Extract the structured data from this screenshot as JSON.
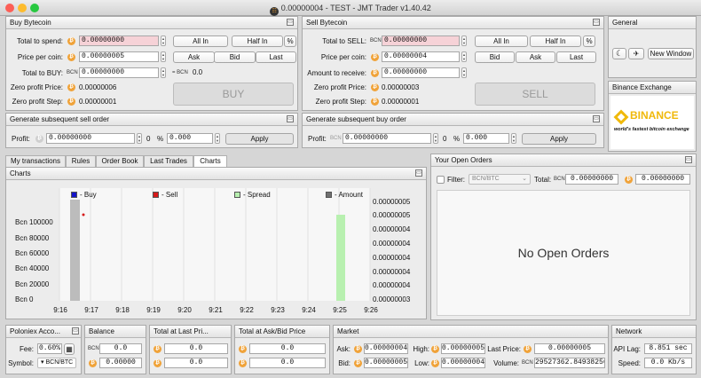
{
  "window": {
    "title": "0.00000004 - TEST - JMT Trader v1.40.42"
  },
  "colors": {
    "coin": "#f0a33a",
    "highlight": "#f6d2d7",
    "buy": "#1515c9",
    "sell": "#d61a1a",
    "spread": "#b8f0b0",
    "amount": "#707070"
  },
  "buy_panel": {
    "title": "Buy Bytecoin",
    "total_to_spend_label": "Total to spend:",
    "total_to_spend": "0.00000000",
    "price_label": "Price per coin:",
    "price": "0.00000005",
    "total_to_buy_label": "Total to BUY:",
    "total_to_buy": "0.00000000",
    "unit": "BCN",
    "eq_label": "= BCN",
    "eq_value": "0.0",
    "zero_price_label": "Zero profit Price:",
    "zero_price": "0.00000006",
    "zero_step_label": "Zero profit Step:",
    "zero_step": "0.00000001",
    "all_in": "All In",
    "half_in": "Half In",
    "pct": "%",
    "ask": "Ask",
    "bid": "Bid",
    "last": "Last",
    "action": "BUY"
  },
  "sell_panel": {
    "title": "Sell Bytecoin",
    "total_to_sell_label": "Total to SELL:",
    "total_to_sell": "0.00000000",
    "price_label": "Price per coin:",
    "price": "0.00000004",
    "receive_label": "Amount to receive:",
    "receive": "0.00000000",
    "unit": "BCN",
    "zero_price_label": "Zero profit Price:",
    "zero_price": "0.00000003",
    "zero_step_label": "Zero profit Step:",
    "zero_step": "0.00000001",
    "all_in": "All In",
    "half_in": "Half In",
    "pct": "%",
    "bid": "Bid",
    "ask": "Ask",
    "last": "Last",
    "action": "SELL"
  },
  "general": {
    "title": "General",
    "new_window": "New Window"
  },
  "exchange": {
    "title": "Binance Exchange",
    "name": "BINANCE",
    "slogan": "world's fastest bitcoin exchange"
  },
  "gen_sell": {
    "title": "Generate subsequent sell order",
    "profit_label": "Profit:",
    "profit": "0.00000000",
    "count": "0",
    "pct_label": "%",
    "pct": "0.000",
    "apply": "Apply"
  },
  "gen_buy": {
    "title": "Generate subsequent buy order",
    "profit_label": "Profit:",
    "unit": "BCN",
    "profit": "0.00000000",
    "count": "0",
    "pct_label": "%",
    "pct": "0.000",
    "apply": "Apply"
  },
  "tabs": [
    "My transactions",
    "Rules",
    "Order Book",
    "Last Trades",
    "Charts"
  ],
  "charts_panel": {
    "title": "Charts"
  },
  "chart_data": {
    "type": "bar",
    "legend": [
      "- Buy",
      "- Sell",
      "- Spread",
      "- Amount"
    ],
    "x_ticks": [
      "9:16",
      "9:17",
      "9:18",
      "9:19",
      "9:20",
      "9:21",
      "9:22",
      "9:23",
      "9:24",
      "9:25",
      "9:26"
    ],
    "y_left_ticks": [
      "Bcn 0",
      "Bcn 20000",
      "Bcn 40000",
      "Bcn 60000",
      "Bcn 80000",
      "Bcn 100000"
    ],
    "y_right_ticks": [
      "0.00000003",
      "0.00000004",
      "0.00000004",
      "0.00000004",
      "0.00000004",
      "0.00000004",
      "0.00000005",
      "0.00000005"
    ],
    "ylim_left": [
      0,
      100000
    ],
    "amount_bars": [
      {
        "x": "9:16",
        "value": 108000
      }
    ],
    "spread_bars": [
      {
        "x": "9:25",
        "low": 3e-08,
        "high": 5e-08
      }
    ],
    "sell_points": [
      {
        "x": "9:16",
        "value": 5e-08
      }
    ]
  },
  "open_orders": {
    "title": "Your Open Orders",
    "filter_label": "Filter:",
    "filter_value": "BCN/BTC",
    "total_label": "Total:",
    "unit": "BCN",
    "total_bcn": "0.00000000",
    "total_btc": "0.00000000",
    "empty": "No Open Orders"
  },
  "poloniex": {
    "title": "Poloniex Acco...",
    "fee_label": "Fee:",
    "fee": "0.60%",
    "symbol_label": "Symbol:",
    "symbol": "BCN/BTC"
  },
  "balance": {
    "title": "Balance",
    "unit": "BCN",
    "bcn": "0.0",
    "btc": "0.00000"
  },
  "total_last": {
    "title": "Total at Last Pri...",
    "v1": "0.0",
    "v2": "0.0"
  },
  "total_askbid": {
    "title": "Total at Ask/Bid Price",
    "v1": "0.0",
    "v2": "0.0"
  },
  "market": {
    "title": "Market",
    "ask_label": "Ask:",
    "ask": "0.00000004",
    "bid_label": "Bid:",
    "bid": "0.00000005",
    "high_label": "High:",
    "high": "0.00000005",
    "low_label": "Low:",
    "low": "0.00000004",
    "last_label": "Last Price:",
    "last": "0.00000005",
    "volume_label": "Volume:",
    "unit": "BCN",
    "volume": "29527362.84938256"
  },
  "network": {
    "title": "Network",
    "lag_label": "API Lag:",
    "lag": "8.851 sec",
    "speed_label": "Speed:",
    "speed": "0.0 Kb/s"
  }
}
